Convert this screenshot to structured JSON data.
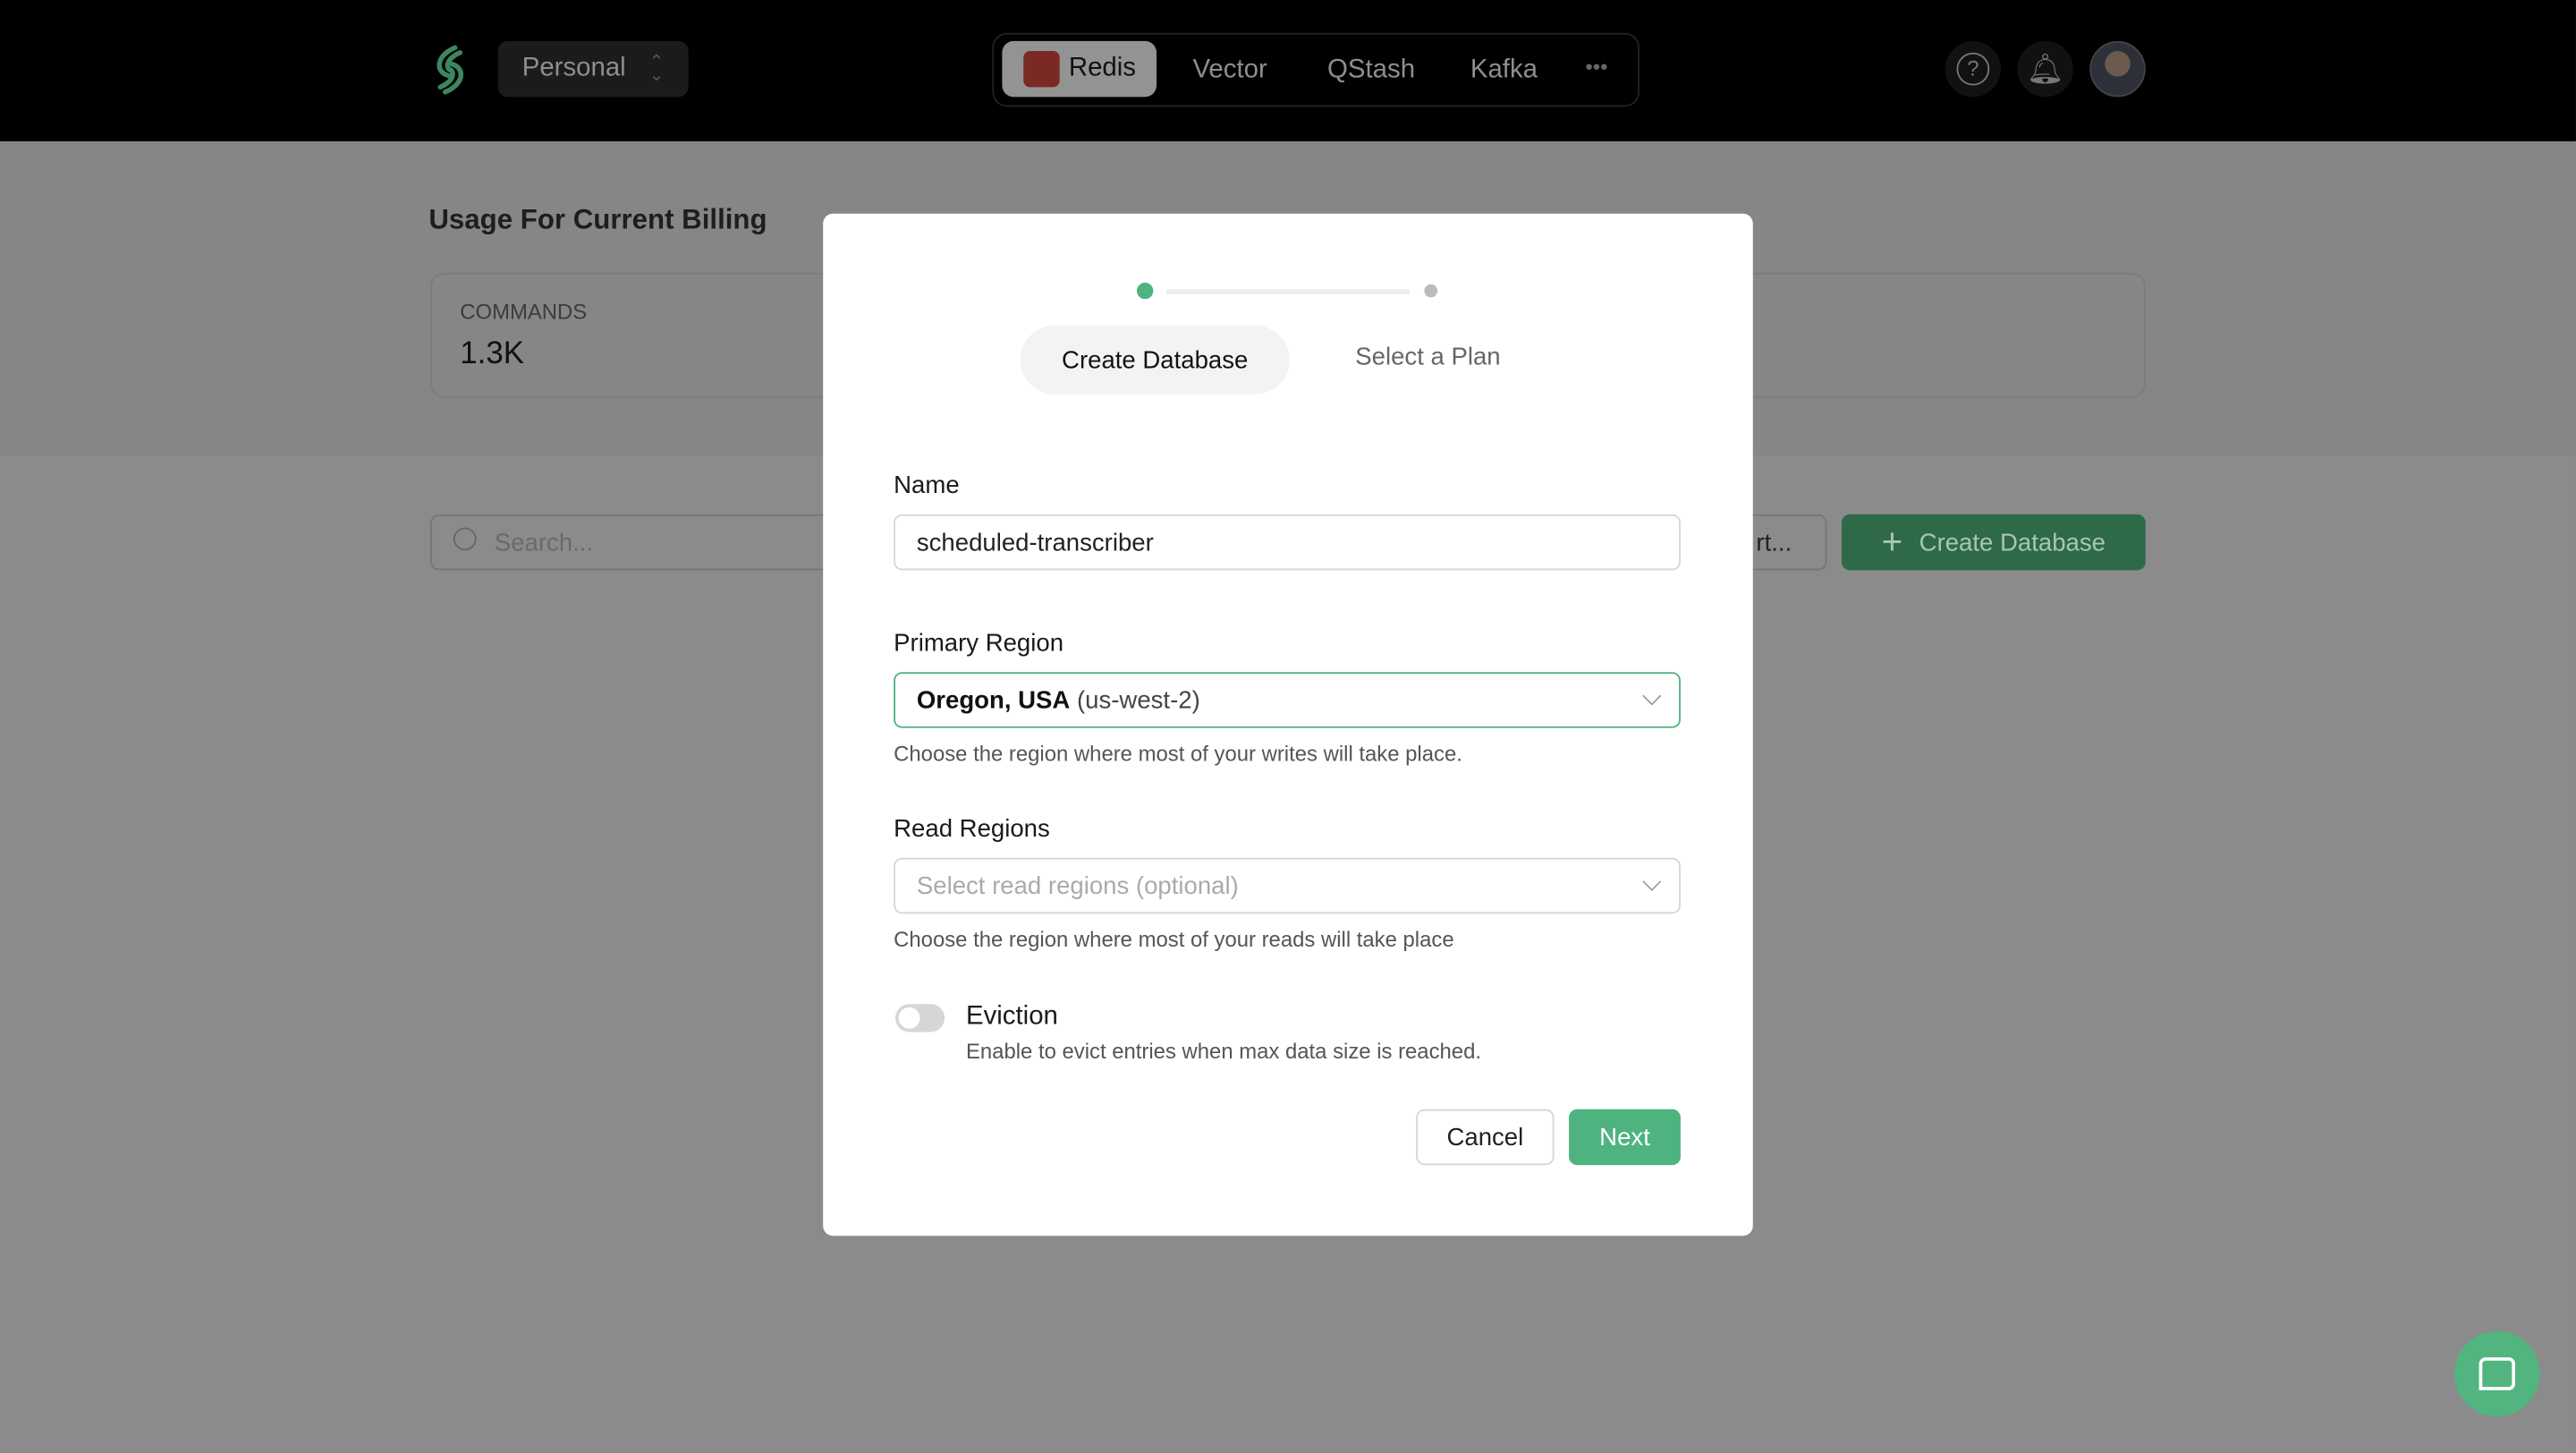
{
  "topbar": {
    "workspace": "Personal",
    "products": [
      "Redis",
      "Vector",
      "QStash",
      "Kafka"
    ],
    "more": "•••",
    "active_product": "Redis"
  },
  "page": {
    "usage_title": "Usage For Current Billing",
    "stat_label": "COMMANDS",
    "stat_value": "1.3K",
    "search_placeholder": "Search...",
    "sort_label": "rt...",
    "create_button": "Create Database"
  },
  "modal": {
    "steps": [
      "Create Database",
      "Select a Plan"
    ],
    "current_step": 1,
    "name_label": "Name",
    "name_value": "scheduled-transcriber",
    "primary_label": "Primary Region",
    "primary_value_bold": "Oregon, USA",
    "primary_value_code": "(us-west-2)",
    "primary_help": "Choose the region where most of your writes will take place.",
    "read_label": "Read Regions",
    "read_placeholder": "Select read regions (optional)",
    "read_help": "Choose the region where most of your reads will take place",
    "eviction_label": "Eviction",
    "eviction_desc": "Enable to evict entries when max data size is reached.",
    "eviction_enabled": false,
    "cancel": "Cancel",
    "next": "Next"
  },
  "colors": {
    "accent": "#4fb37f",
    "redis": "#7a2a22"
  }
}
